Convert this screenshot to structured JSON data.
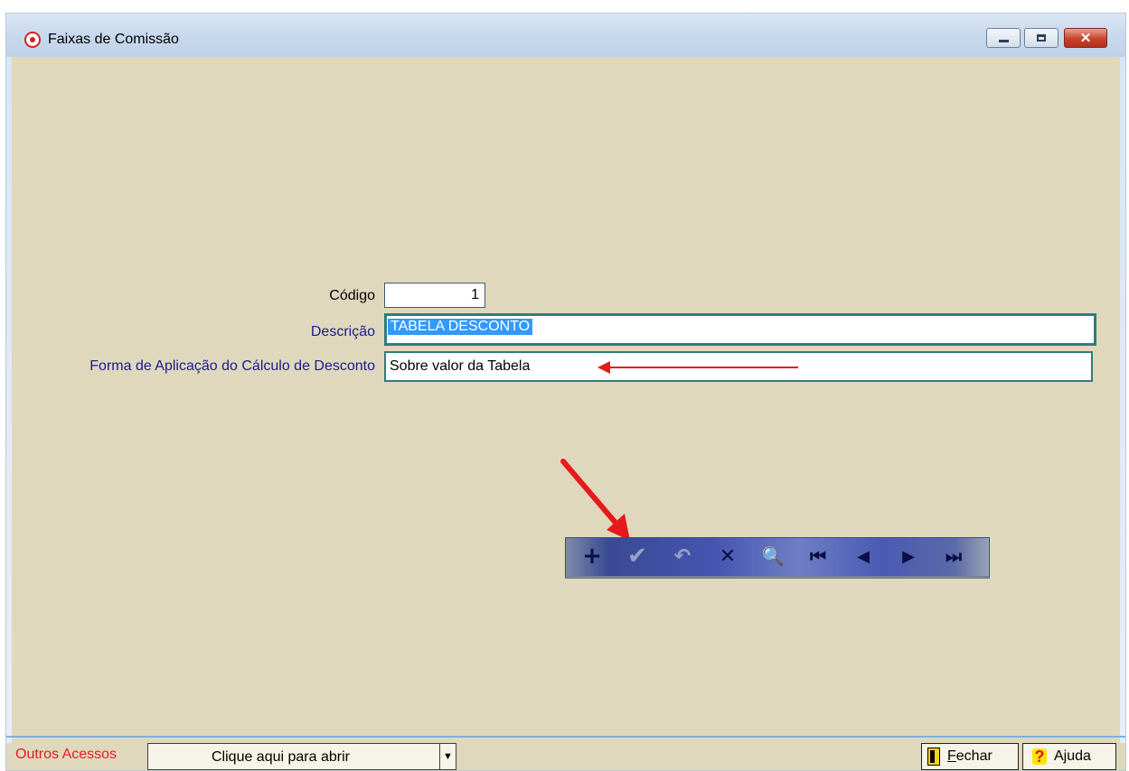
{
  "window": {
    "title": "Faixas de Comissão",
    "controls": {
      "minimize": "minimize",
      "maximize": "maximize",
      "close": "x"
    }
  },
  "form": {
    "codigo": {
      "label": "Código",
      "value": "1"
    },
    "descricao": {
      "label": "Descrição",
      "value": "TABELA DESCONTO"
    },
    "forma_aplicacao": {
      "label": "Forma de Aplicação do Cálculo de Desconto",
      "value": "Sobre valor da Tabela"
    }
  },
  "toolbar": {
    "buttons": [
      {
        "name": "add",
        "glyph": "+",
        "enabled": true
      },
      {
        "name": "confirm",
        "glyph": "✔",
        "enabled": false
      },
      {
        "name": "undo",
        "glyph": "↶",
        "enabled": false
      },
      {
        "name": "delete",
        "glyph": "✕",
        "enabled": true
      },
      {
        "name": "search",
        "glyph": "🔍",
        "enabled": true
      },
      {
        "name": "first",
        "glyph": "⏮",
        "enabled": true
      },
      {
        "name": "previous",
        "glyph": "◀",
        "enabled": true
      },
      {
        "name": "next",
        "glyph": "▶",
        "enabled": true
      },
      {
        "name": "last",
        "glyph": "⏭",
        "enabled": true
      }
    ]
  },
  "footer": {
    "outros_acessos_label": "Outros Acessos",
    "combo_text": "Clique aqui para abrir",
    "fechar_label_first": "F",
    "fechar_label_rest": "echar",
    "ajuda_label": "Ajuda"
  },
  "colors": {
    "window_bg": "#e0d8bd",
    "label_blue": "#1a1a8c",
    "selection_bg": "#3399ff",
    "annotation_red": "#e51b1b",
    "field_border_teal": "#2e7d7a"
  }
}
